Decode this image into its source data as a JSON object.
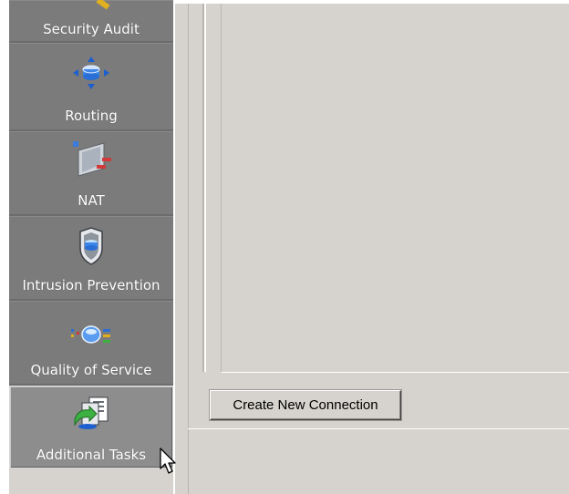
{
  "taskbar": {
    "items": [
      {
        "label": "Security Audit",
        "icon": "security-audit-icon"
      },
      {
        "label": "Routing",
        "icon": "routing-icon"
      },
      {
        "label": "NAT",
        "icon": "nat-icon"
      },
      {
        "label": "Intrusion Prevention",
        "icon": "shield-icon"
      },
      {
        "label": "Quality of Service",
        "icon": "qos-icon"
      },
      {
        "label": "Additional Tasks",
        "icon": "additional-tasks-icon"
      }
    ],
    "active": "Additional Tasks"
  },
  "main": {
    "create_button_label": "Create New Connection"
  },
  "colors": {
    "taskbar_bg": "#7b7b7b",
    "window_bg": "#d6d3ce",
    "accent_blue": "#2a6fd6"
  }
}
